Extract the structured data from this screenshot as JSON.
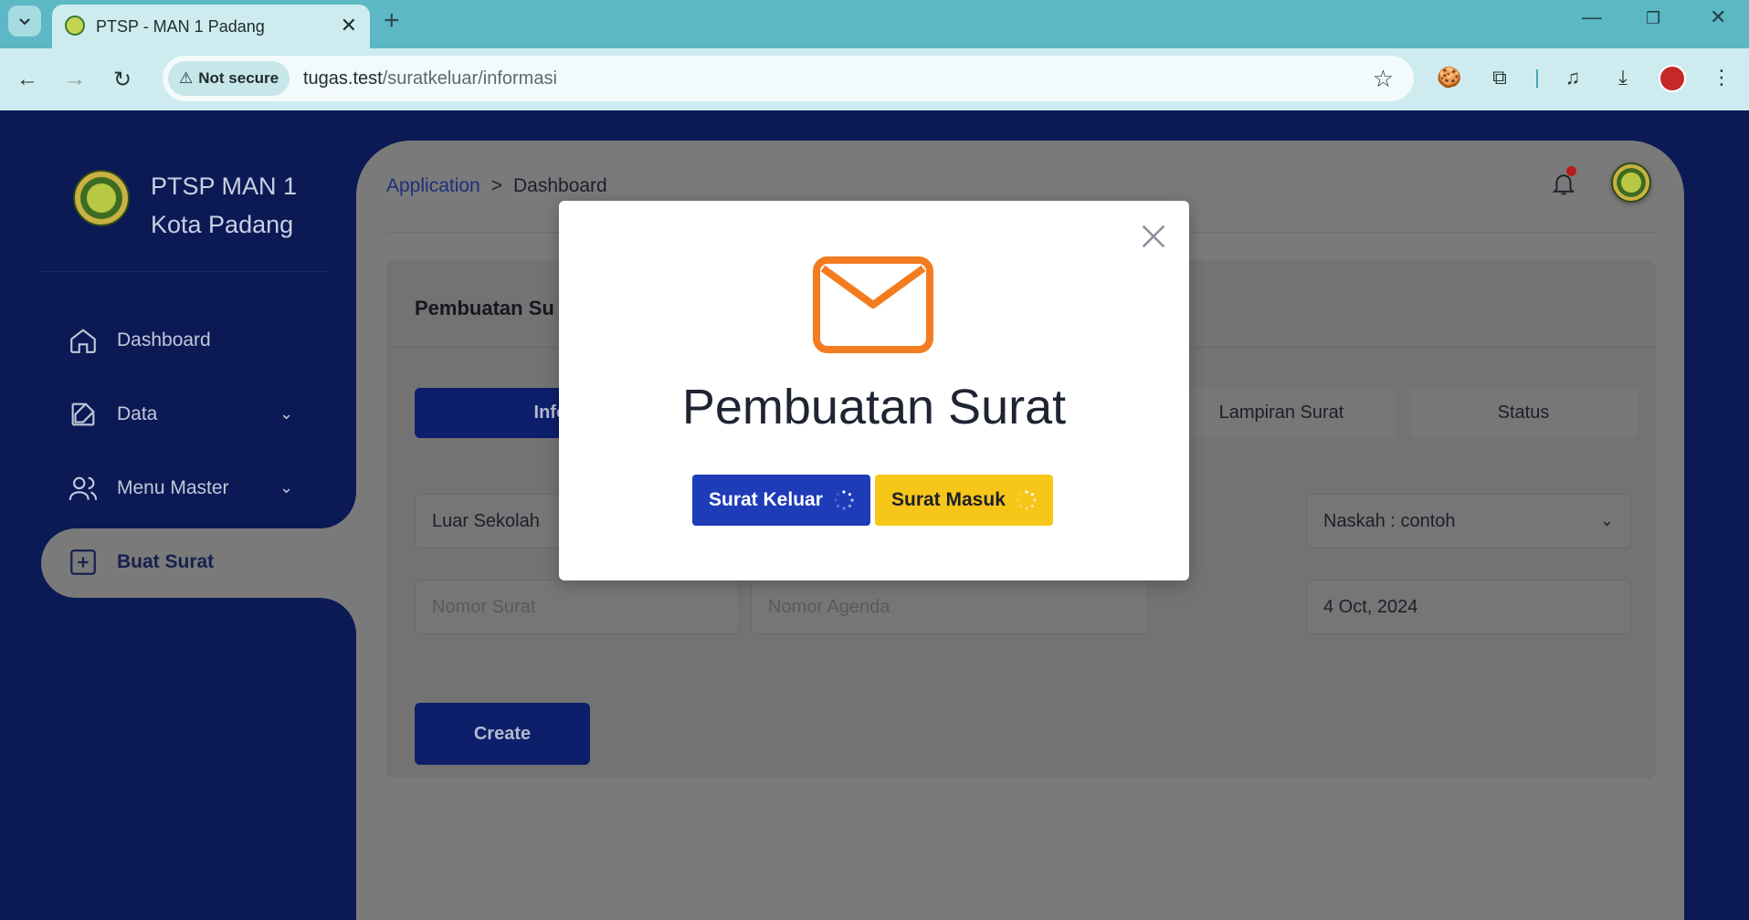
{
  "browser": {
    "tab_title": "PTSP - MAN 1 Padang",
    "security_label": "Not secure",
    "url_host": "tugas.test",
    "url_path": "/suratkeluar/informasi"
  },
  "sidebar": {
    "brand_line1": "PTSP MAN 1",
    "brand_line2": "Kota Padang",
    "items": [
      {
        "label": "Dashboard"
      },
      {
        "label": "Data"
      },
      {
        "label": "Menu Master"
      },
      {
        "label": "Buat Surat"
      }
    ]
  },
  "header": {
    "breadcrumb_root": "Application",
    "breadcrumb_separator": ">",
    "breadcrumb_current": "Dashboard"
  },
  "card": {
    "title": "Pembuatan Su",
    "steps": [
      {
        "label": "Informasi S"
      },
      {
        "label": "Lampiran Surat"
      },
      {
        "label": "Status"
      }
    ],
    "fields": {
      "asal": "Luar Sekolah",
      "naskah": "Naskah : contoh",
      "nomor_surat_placeholder": "Nomor Surat",
      "nomor_agenda_placeholder": "Nomor Agenda",
      "tanggal": "4 Oct, 2024"
    },
    "create_label": "Create"
  },
  "modal": {
    "title": "Pembuatan Surat",
    "btn_keluar": "Surat Keluar",
    "btn_masuk": "Surat Masuk",
    "icon": "envelope-icon",
    "icon_color": "#f47c20"
  },
  "colors": {
    "sidebar_bg": "#0b1a55",
    "primary": "#1e3bb8",
    "warning": "#f6c619"
  }
}
